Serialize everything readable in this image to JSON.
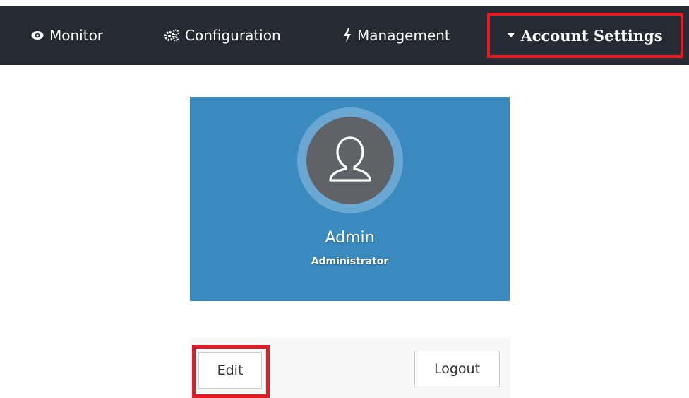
{
  "navbar": {
    "items": [
      {
        "label": "Monitor",
        "icon": "eye-icon"
      },
      {
        "label": "Configuration",
        "icon": "cogs-icon"
      },
      {
        "label": "Management",
        "icon": "bolt-icon"
      },
      {
        "label": "Account Settings",
        "icon": "caret-down-icon",
        "highlighted": true
      }
    ]
  },
  "profile": {
    "name": "Admin",
    "role": "Administrator",
    "avatar_icon": "user-icon",
    "panel_color": "#3a8ac0"
  },
  "actions": {
    "edit_label": "Edit",
    "logout_label": "Logout"
  },
  "colors": {
    "navbar_bg": "#262a33",
    "highlight": "#e21b24"
  }
}
